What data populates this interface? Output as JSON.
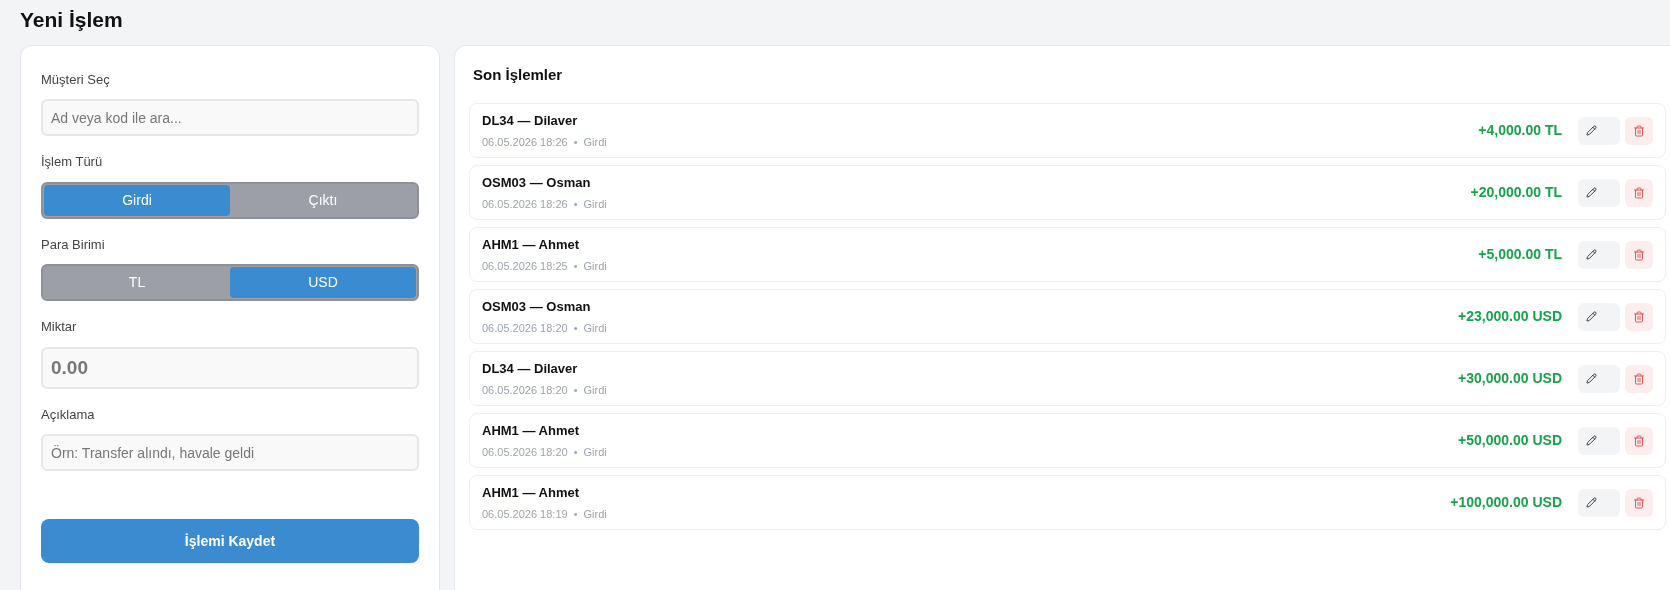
{
  "page_title": "Yeni İşlem",
  "form": {
    "fields": [
      {
        "kind": "input",
        "label": "Müşteri Seç",
        "placeholder": "Ad veya kod ile ara..."
      },
      {
        "kind": "toggle",
        "label": "İşlem Türü",
        "options": [
          {
            "label": "Girdi",
            "selected": true
          },
          {
            "label": "Çıktı",
            "selected": false
          }
        ]
      },
      {
        "kind": "toggle",
        "label": "Para Birimi",
        "options": [
          {
            "label": "TL",
            "selected": false
          },
          {
            "label": "USD",
            "selected": true
          }
        ]
      },
      {
        "kind": "amount",
        "label": "Miktar",
        "placeholder": "0.00"
      },
      {
        "kind": "input",
        "label": "Açıklama",
        "placeholder": "Örn: Transfer alındı, havale geldi"
      }
    ],
    "submit": "İşlemi Kaydet"
  },
  "recent": {
    "title": "Son İşlemler",
    "items": [
      {
        "name": "DL34 — Dilaver",
        "date": "06.05.2026 18:26",
        "separator": "•",
        "type": "Girdi",
        "amount": "+4,000.00 TL"
      },
      {
        "name": "OSM03 — Osman",
        "date": "06.05.2026 18:26",
        "separator": "•",
        "type": "Girdi",
        "amount": "+20,000.00 TL"
      },
      {
        "name": "AHM1 — Ahmet",
        "date": "06.05.2026 18:25",
        "separator": "•",
        "type": "Girdi",
        "amount": "+5,000.00 TL"
      },
      {
        "name": "OSM03 — Osman",
        "date": "06.05.2026 18:20",
        "separator": "•",
        "type": "Girdi",
        "amount": "+23,000.00 USD"
      },
      {
        "name": "DL34 — Dilaver",
        "date": "06.05.2026 18:20",
        "separator": "•",
        "type": "Girdi",
        "amount": "+30,000.00 USD"
      },
      {
        "name": "AHM1 — Ahmet",
        "date": "06.05.2026 18:20",
        "separator": "•",
        "type": "Girdi",
        "amount": "+50,000.00 USD"
      },
      {
        "name": "AHM1 — Ahmet",
        "date": "06.05.2026 18:19",
        "separator": "•",
        "type": "Girdi",
        "amount": "+100,000.00 USD"
      }
    ]
  }
}
